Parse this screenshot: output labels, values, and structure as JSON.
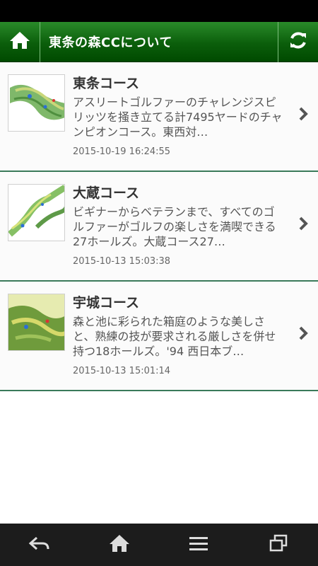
{
  "header": {
    "title": "東条の森CCについて",
    "home_icon": "home-icon",
    "refresh_icon": "refresh-icon"
  },
  "courses": [
    {
      "title": "東条コース",
      "desc": "アスリートゴルファーのチャレンジスピリッツを掻き立てる計7495ヤードのチャンピオンコース。東西対…",
      "date": "2015-10-19 16:24:55"
    },
    {
      "title": "大蔵コース",
      "desc": "ビギナーからベテランまで、すべてのゴルファーがゴルフの楽しさを満喫できる27ホールズ。大蔵コース27…",
      "date": "2015-10-13 15:03:38"
    },
    {
      "title": "宇城コース",
      "desc": "森と池に彩られた箱庭のような美しさと、熟練の技が要求される厳しさを併せ持つ18ホールズ。'94 西日本ブ…",
      "date": "2015-10-13 15:01:14"
    }
  ],
  "navbar": {
    "icons": [
      "back-icon",
      "home-icon",
      "menu-icon",
      "recent-apps-icon"
    ]
  },
  "colors": {
    "header_green": "#0b5e0b",
    "divider": "#3a7a5a"
  }
}
